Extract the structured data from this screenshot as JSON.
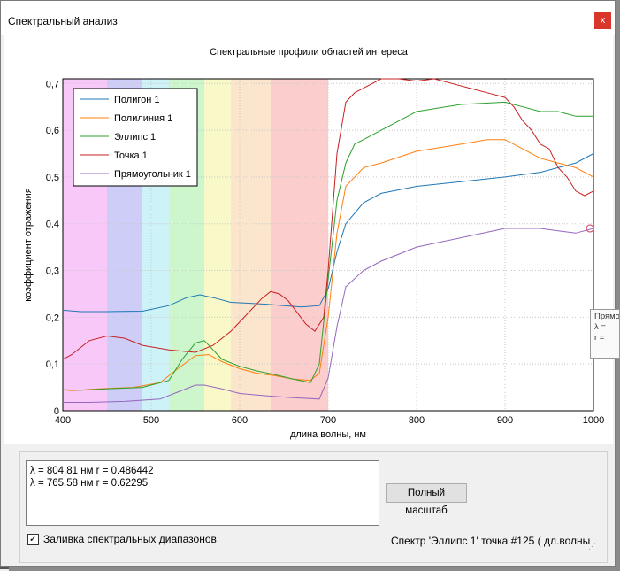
{
  "window": {
    "title": "Спектральный анализ",
    "close_label": "x"
  },
  "chart_data": {
    "type": "line",
    "title": "Спектральные профили областей интереса",
    "xlabel": "длина волны, нм",
    "ylabel": "коэффициент отражения",
    "xlim": [
      400,
      1000
    ],
    "ylim": [
      0,
      0.71
    ],
    "x_ticks": [
      400,
      500,
      600,
      700,
      800,
      900,
      1000
    ],
    "y_ticks": [
      0,
      0.1,
      0.2,
      0.3,
      0.4,
      0.5,
      0.6,
      0.7
    ],
    "y_tick_labels": [
      "0",
      "0,1",
      "0,2",
      "0,3",
      "0,4",
      "0,5",
      "0,6",
      "0,7"
    ],
    "grid": true,
    "legend_position": "top-left",
    "bands": [
      {
        "from": 400,
        "to": 450,
        "color": "#f7c0f7"
      },
      {
        "from": 450,
        "to": 490,
        "color": "#c4c4f7"
      },
      {
        "from": 490,
        "to": 520,
        "color": "#c4f0f7"
      },
      {
        "from": 520,
        "to": 560,
        "color": "#c4f5c4"
      },
      {
        "from": 560,
        "to": 590,
        "color": "#f7f7c0"
      },
      {
        "from": 590,
        "to": 635,
        "color": "#fbe0c4"
      },
      {
        "from": 635,
        "to": 700,
        "color": "#fbc4c4"
      }
    ],
    "series": [
      {
        "name": "Полигон 1",
        "color": "#1f77b4",
        "x": [
          400,
          420,
          450,
          490,
          520,
          540,
          555,
          570,
          590,
          610,
          630,
          650,
          670,
          690,
          700,
          710,
          720,
          740,
          760,
          800,
          850,
          900,
          940,
          960,
          980,
          1000
        ],
        "y": [
          0.215,
          0.212,
          0.212,
          0.213,
          0.225,
          0.242,
          0.248,
          0.242,
          0.232,
          0.23,
          0.228,
          0.225,
          0.222,
          0.225,
          0.26,
          0.34,
          0.4,
          0.445,
          0.465,
          0.48,
          0.49,
          0.5,
          0.51,
          0.52,
          0.53,
          0.55
        ]
      },
      {
        "name": "Полилиния 1",
        "color": "#ff7f0e",
        "x": [
          400,
          410,
          440,
          480,
          510,
          530,
          550,
          565,
          580,
          600,
          620,
          640,
          660,
          680,
          690,
          700,
          710,
          720,
          740,
          760,
          800,
          850,
          880,
          900,
          910,
          920,
          940,
          960,
          980,
          1000
        ],
        "y": [
          0.045,
          0.043,
          0.047,
          0.05,
          0.06,
          0.09,
          0.118,
          0.12,
          0.105,
          0.09,
          0.08,
          0.075,
          0.068,
          0.065,
          0.08,
          0.2,
          0.38,
          0.48,
          0.52,
          0.53,
          0.555,
          0.57,
          0.58,
          0.58,
          0.57,
          0.56,
          0.54,
          0.53,
          0.52,
          0.5
        ]
      },
      {
        "name": "Эллипс 1",
        "color": "#2ca02c",
        "x": [
          400,
          420,
          450,
          490,
          520,
          535,
          550,
          560,
          570,
          580,
          600,
          620,
          640,
          660,
          680,
          690,
          700,
          710,
          720,
          730,
          740,
          760,
          800,
          850,
          900,
          920,
          940,
          960,
          980,
          1000
        ],
        "y": [
          0.045,
          0.044,
          0.047,
          0.05,
          0.065,
          0.11,
          0.145,
          0.15,
          0.13,
          0.11,
          0.095,
          0.085,
          0.077,
          0.068,
          0.06,
          0.1,
          0.28,
          0.45,
          0.53,
          0.57,
          0.58,
          0.6,
          0.64,
          0.655,
          0.66,
          0.65,
          0.64,
          0.64,
          0.63,
          0.63
        ]
      },
      {
        "name": "Точка 1",
        "color": "#c82020",
        "x": [
          400,
          410,
          430,
          450,
          470,
          490,
          520,
          550,
          570,
          590,
          610,
          625,
          635,
          645,
          655,
          665,
          675,
          685,
          695,
          700,
          710,
          720,
          730,
          740,
          760,
          780,
          800,
          820,
          840,
          860,
          880,
          900,
          910,
          920,
          930,
          940,
          950,
          960,
          970,
          980,
          990,
          1000
        ],
        "y": [
          0.11,
          0.12,
          0.15,
          0.16,
          0.155,
          0.14,
          0.13,
          0.125,
          0.14,
          0.17,
          0.21,
          0.24,
          0.255,
          0.25,
          0.235,
          0.21,
          0.185,
          0.17,
          0.2,
          0.3,
          0.55,
          0.66,
          0.68,
          0.69,
          0.71,
          0.71,
          0.705,
          0.71,
          0.7,
          0.69,
          0.68,
          0.67,
          0.65,
          0.62,
          0.6,
          0.57,
          0.56,
          0.52,
          0.5,
          0.47,
          0.46,
          0.47
        ]
      },
      {
        "name": "Прямоугольник 1",
        "color": "#9467bd",
        "x": [
          400,
          430,
          470,
          510,
          530,
          550,
          560,
          580,
          600,
          630,
          660,
          690,
          700,
          710,
          720,
          740,
          760,
          800,
          850,
          900,
          940,
          960,
          980,
          1000
        ],
        "y": [
          0.018,
          0.018,
          0.02,
          0.025,
          0.04,
          0.055,
          0.055,
          0.047,
          0.037,
          0.032,
          0.028,
          0.025,
          0.07,
          0.18,
          0.265,
          0.3,
          0.32,
          0.35,
          0.37,
          0.39,
          0.39,
          0.385,
          0.38,
          0.39
        ]
      }
    ]
  },
  "readout": {
    "line1": "λ = 804.81 нм r = 0.486442",
    "line2": "λ = 765.58 нм r = 0.62295"
  },
  "zoom_button": "Полный масштаб",
  "fill_checkbox": {
    "label": "Заливка спектральных диапазонов",
    "checked": true,
    "check_glyph": "✓"
  },
  "status": "Спектр 'Эллипс 1' точка #125 ( дл.волны",
  "side_tooltip": {
    "line1": "Прямо",
    "line2": "λ =",
    "line3": "r ="
  }
}
